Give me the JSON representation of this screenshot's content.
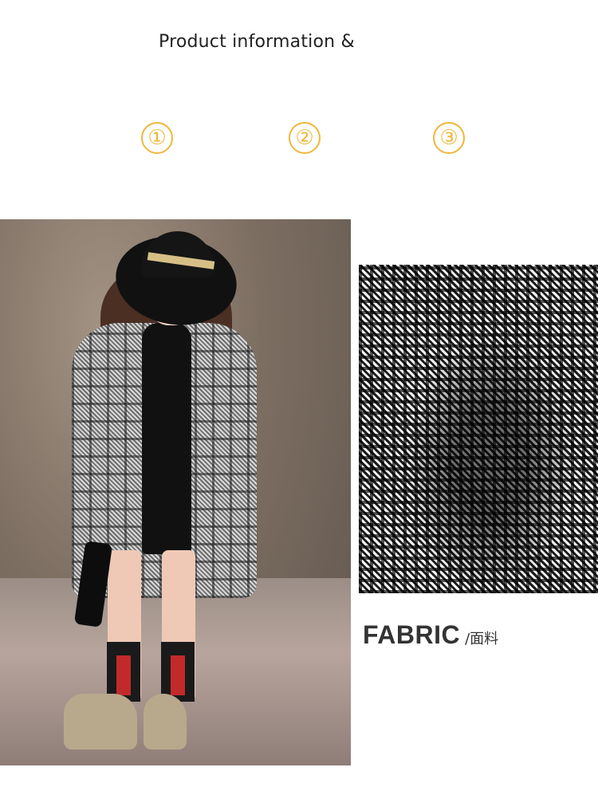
{
  "header": {
    "title": "Product information &"
  },
  "steps": [
    {
      "label": "①"
    },
    {
      "label": "②"
    },
    {
      "label": "③"
    }
  ],
  "accent_color": "#f0b73a",
  "images": {
    "model": {
      "alt": "girl-in-plaid-coat-photo"
    },
    "fabric": {
      "alt": "houndstooth-fabric-closeup-photo"
    }
  },
  "fabric_section": {
    "label_en": "FABRIC",
    "label_cn": "/面料"
  }
}
